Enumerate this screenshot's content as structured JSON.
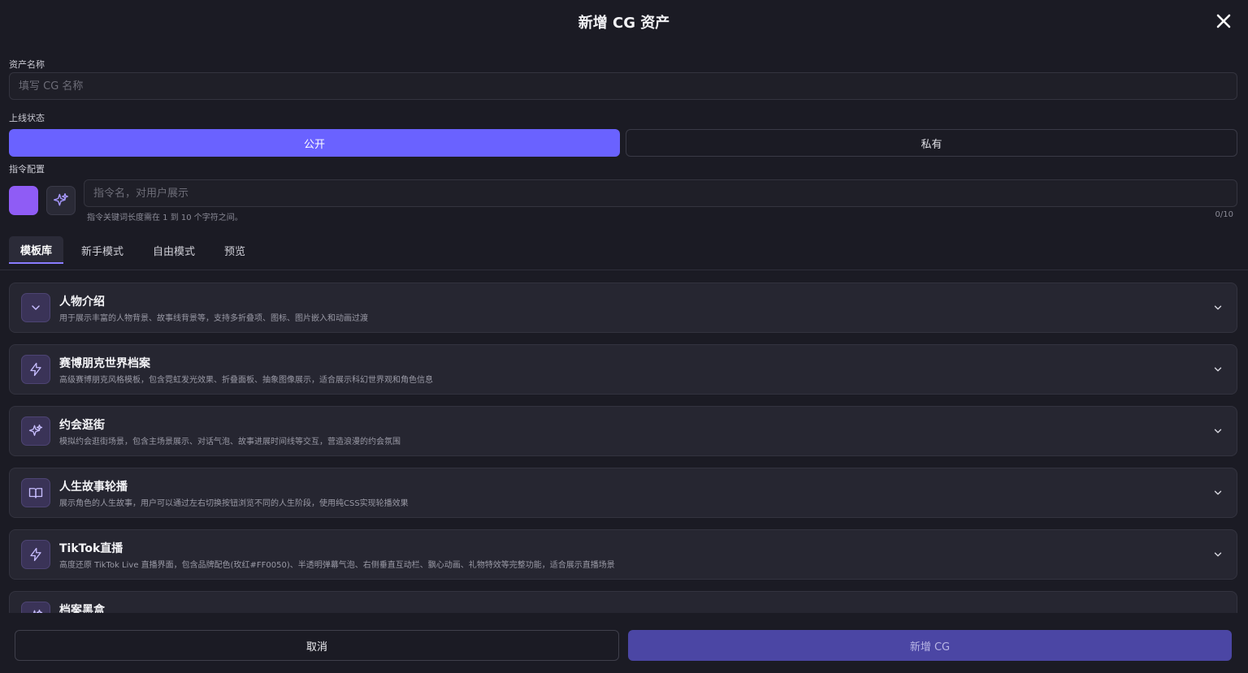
{
  "dialog": {
    "title": "新增 CG 资产"
  },
  "form": {
    "name_label": "资产名称",
    "name_placeholder": "填写 CG 名称",
    "name_value": "",
    "status_label": "上线状态",
    "status_options": [
      "公开",
      "私有"
    ],
    "status_selected": "公开",
    "command_label": "指令配置",
    "command_placeholder": "指令名，对用户展示",
    "command_hint": "指令关键词长度需在 1 到 10 个字符之间。",
    "command_counter": "0/10",
    "color_accent": "#8f5cf5"
  },
  "tabs": [
    {
      "label": "模板库",
      "active": true
    },
    {
      "label": "新手模式",
      "active": false
    },
    {
      "label": "自由模式",
      "active": false
    },
    {
      "label": "预览",
      "active": false
    }
  ],
  "templates": [
    {
      "icon": "chevron-down-icon",
      "title": "人物介绍",
      "desc": "用于展示丰富的人物背景、故事线背景等，支持多折叠项、图标、图片嵌入和动画过渡"
    },
    {
      "icon": "lightning-icon",
      "title": "赛博朋克世界档案",
      "desc": "高级赛博朋克风格模板，包含霓虹发光效果、折叠面板、抽象图像展示，适合展示科幻世界观和角色信息"
    },
    {
      "icon": "sparkles-icon",
      "title": "约会逛街",
      "desc": "模拟约会逛街场景，包含主场景展示、对话气泡、故事进展时间线等交互，营造浪漫的约会氛围"
    },
    {
      "icon": "book-icon",
      "title": "人生故事轮播",
      "desc": "展示角色的人生故事，用户可以通过左右切换按钮浏览不同的人生阶段，使用纯CSS实现轮播效果"
    },
    {
      "icon": "lightning-icon",
      "title": "TikTok直播",
      "desc": "高度还原 TikTok Live 直播界面，包含品牌配色(玫红#FF0050)、半透明弹幕气泡、右侧垂直互动栏、飘心动画、礼物特效等完整功能，适合展示直播场景"
    },
    {
      "icon": "sparkles-icon",
      "title": "档案黑盒",
      "desc": ""
    }
  ],
  "footer": {
    "cancel_label": "取消",
    "submit_label": "新增 CG"
  },
  "colors": {
    "primary": "#6a62ff",
    "submit_disabled": "#4b46a4",
    "background": "#1b1b24"
  }
}
